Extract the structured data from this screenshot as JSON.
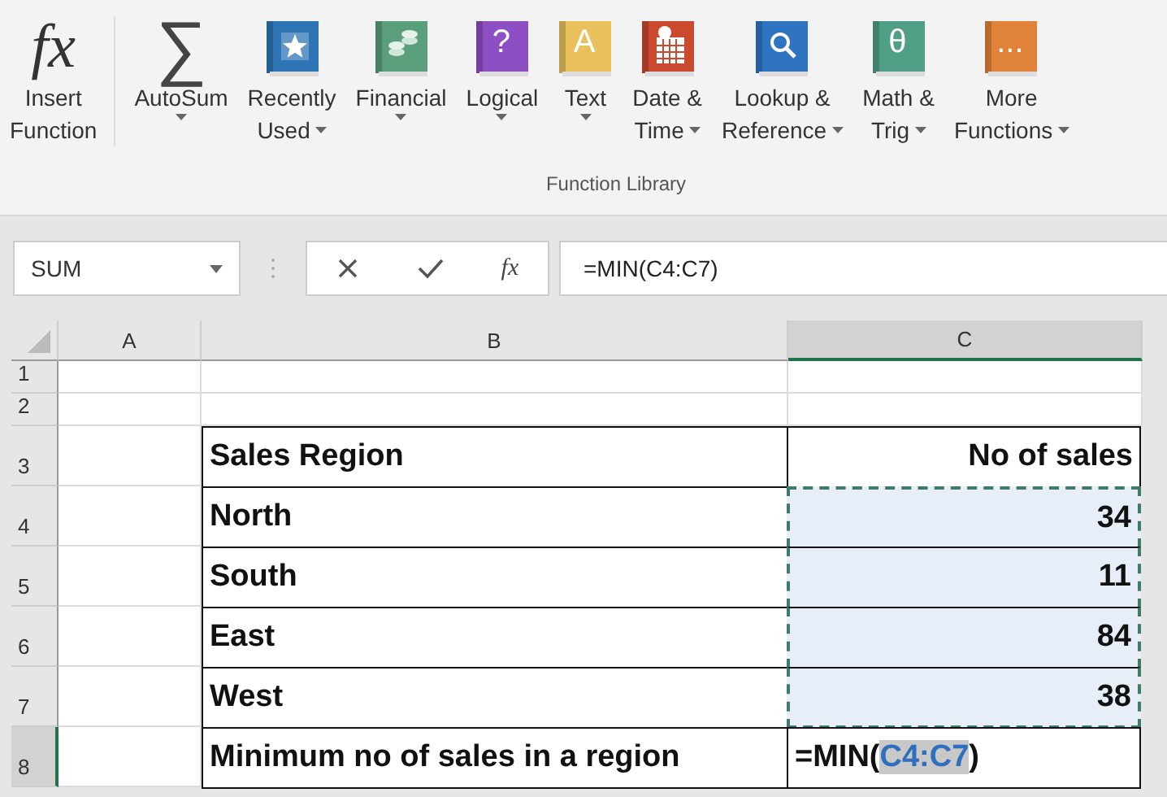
{
  "ribbon": {
    "group_label": "Function Library",
    "buttons": [
      {
        "label": [
          "Insert",
          "Function"
        ],
        "dropdown": false,
        "icon": {
          "kind": "fx",
          "glyph": "fx"
        }
      },
      {
        "label": [
          "AutoSum"
        ],
        "dropdown": true,
        "icon": {
          "kind": "sigma",
          "glyph": "∑"
        }
      },
      {
        "label": [
          "Recently",
          "Used"
        ],
        "dropdown": true,
        "icon": {
          "kind": "star",
          "color": "#2e75b6"
        }
      },
      {
        "label": [
          "Financial"
        ],
        "dropdown": true,
        "icon": {
          "kind": "coins",
          "color": "#5a9e7c"
        }
      },
      {
        "label": [
          "Logical"
        ],
        "dropdown": true,
        "icon": {
          "kind": "glyph",
          "color": "#8e4fc4",
          "glyph": "?"
        }
      },
      {
        "label": [
          "Text"
        ],
        "dropdown": true,
        "icon": {
          "kind": "glyph",
          "color": "#e8c15d",
          "glyph": "A"
        }
      },
      {
        "label": [
          "Date &",
          "Time"
        ],
        "dropdown": true,
        "icon": {
          "kind": "calendar",
          "color": "#c94a2e"
        }
      },
      {
        "label": [
          "Lookup &",
          "Reference"
        ],
        "dropdown": true,
        "icon": {
          "kind": "magnifier",
          "color": "#2f74c0"
        }
      },
      {
        "label": [
          "Math &",
          "Trig"
        ],
        "dropdown": true,
        "icon": {
          "kind": "glyph",
          "color": "#4f9e85",
          "glyph": "θ"
        }
      },
      {
        "label": [
          "More",
          "Functions"
        ],
        "dropdown": true,
        "icon": {
          "kind": "glyph",
          "color": "#e0823a",
          "glyph": "..."
        }
      }
    ]
  },
  "formula_bar": {
    "name_box": "SUM",
    "formula": "=MIN(C4:C7)"
  },
  "columns": [
    {
      "label": "A",
      "selected": false
    },
    {
      "label": "B",
      "selected": false
    },
    {
      "label": "C",
      "selected": true
    }
  ],
  "rows": [
    {
      "number": "1",
      "selected": false
    },
    {
      "number": "2",
      "selected": false
    },
    {
      "number": "3",
      "selected": false,
      "kind": "header",
      "region": "Sales Region",
      "sales": "No of sales"
    },
    {
      "number": "4",
      "selected": false,
      "kind": "data",
      "region": "North",
      "sales": "34",
      "in_reference": true
    },
    {
      "number": "5",
      "selected": false,
      "kind": "data",
      "region": "South",
      "sales": "11",
      "in_reference": true
    },
    {
      "number": "6",
      "selected": false,
      "kind": "data",
      "region": "East",
      "sales": "84",
      "in_reference": true
    },
    {
      "number": "7",
      "selected": false,
      "kind": "data",
      "region": "West",
      "sales": "38",
      "in_reference": true
    },
    {
      "number": "8",
      "selected": true,
      "kind": "formula",
      "region": "Minimum no of sales in a region",
      "formula_start": "=MIN(",
      "formula_reference": "C4:C7",
      "formula_end": ")"
    }
  ]
}
